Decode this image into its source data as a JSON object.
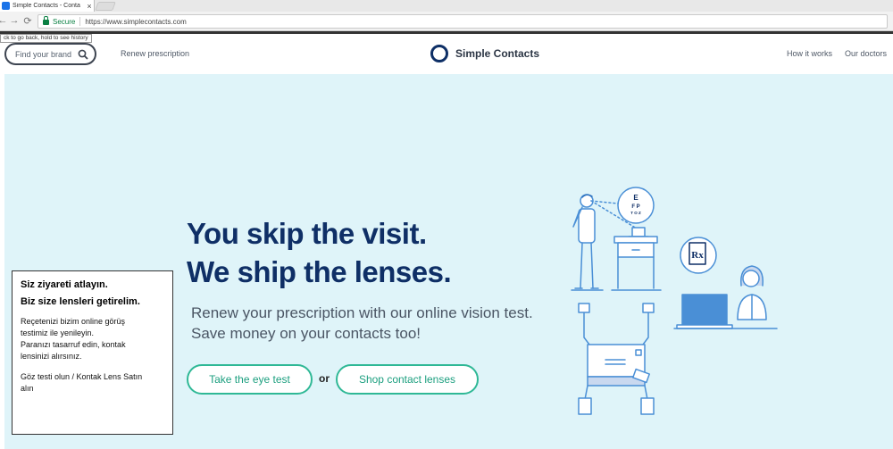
{
  "browser": {
    "tab_title": "Simple Contacts - Conta",
    "tab_close": "×",
    "url_secure_label": "Secure",
    "url": "https://www.simplecontacts.com",
    "back_tooltip": "ck to go back, hold to see history",
    "nav": {
      "back": "←",
      "forward": "→",
      "reload": "⟳"
    }
  },
  "header": {
    "search_placeholder": "Find your brand",
    "renew_link": "Renew prescription",
    "brand_name": "Simple Contacts",
    "links": [
      "How it works",
      "Our doctors"
    ]
  },
  "hero": {
    "headline_line1": "You skip the visit.",
    "headline_line2": "We ship the lenses.",
    "sub_line1": "Renew your prescription with our online vision test.",
    "sub_line2": "Save money on your contacts too!",
    "primary_cta": "Take the eye test",
    "or_text": "or",
    "secondary_cta": "Shop contact lenses",
    "eye_chart_letters": [
      "E",
      "F P",
      "T O Z"
    ],
    "rx_symbol": "Rx"
  },
  "note": {
    "title_line1": "Siz ziyareti atlayın.",
    "title_line2": "Biz size lensleri getirelim.",
    "body_line1": "Reçetenizi bizim online görüş",
    "body_line2": "testimiz ile yenileyin.",
    "body_line3": "Paranızı tasarruf edin, kontak",
    "body_line4": "lensinizi alırsınız.",
    "footer_line1": "Göz testi olun / Kontak Lens Satın",
    "footer_line2": "alın"
  },
  "colors": {
    "navy": "#0f2f66",
    "teal": "#2fb896",
    "hero_bg": "#dff4f9",
    "illustration_blue": "#4a8fd6"
  }
}
